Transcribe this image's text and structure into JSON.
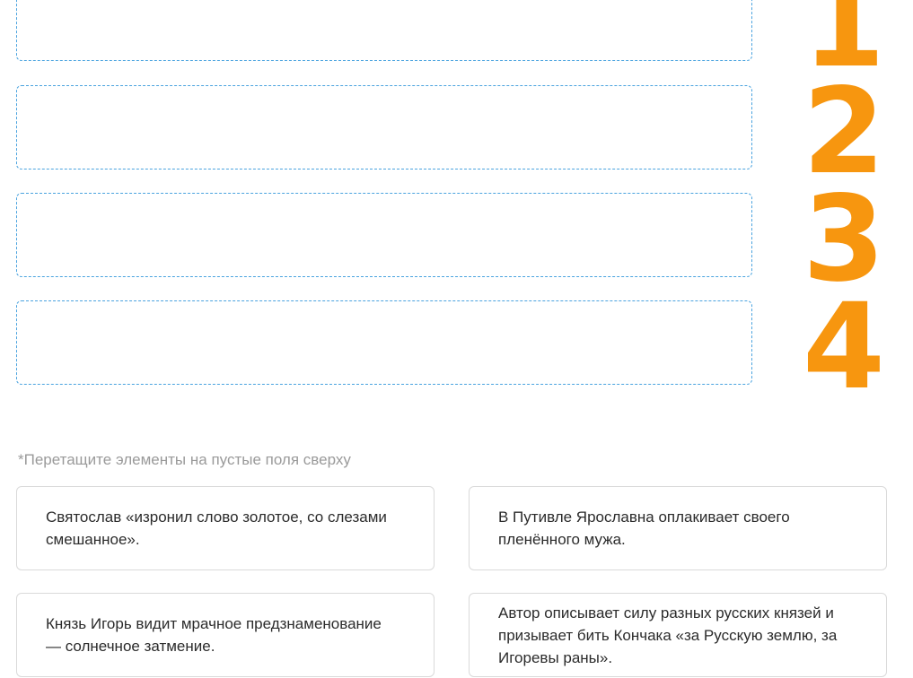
{
  "slots": [
    {
      "number": "1"
    },
    {
      "number": "2"
    },
    {
      "number": "3"
    },
    {
      "number": "4"
    }
  ],
  "hint": "*Перетащите элементы на пустые поля сверху",
  "cards": [
    {
      "text": "Святослав «изронил слово золотое, со слезами смешанное»."
    },
    {
      "text": "В Путивле Ярославна оплакивает своего пленённого мужа."
    },
    {
      "text": "Князь Игорь видит мрачное предзнаменование — солнечное затмение."
    },
    {
      "text": "Автор описывает силу разных русских князей и призывает бить Кончака «за Русскую землю, за Игоревы раны»."
    }
  ],
  "colors": {
    "accent": "#f7960f",
    "dropzone_border": "#4aa3df",
    "card_border": "#dadada",
    "hint_text": "#9a9a9a"
  }
}
